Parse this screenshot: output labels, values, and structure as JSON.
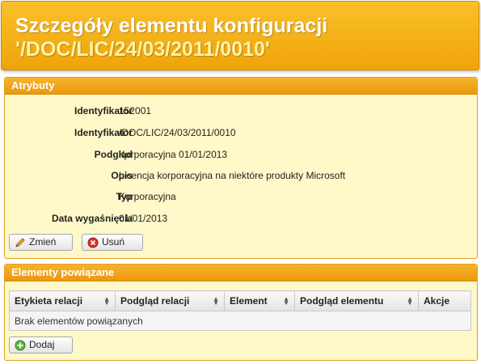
{
  "header": {
    "title": "Szczegóły elementu konfiguracji",
    "identifier": "'/DOC/LIC/24/03/2011/0010'"
  },
  "attributes": {
    "heading": "Atrybuty",
    "rows": [
      {
        "label": "Identyfikator",
        "value": "152001"
      },
      {
        "label": "Identyfikator",
        "value": "/DOC/LIC/24/03/2011/0010"
      },
      {
        "label": "Podgląd",
        "value": "Korporacyjna 01/01/2013"
      },
      {
        "label": "Opis",
        "value": "Licencja korporacyjna na niektóre produkty Microsoft"
      },
      {
        "label": "Typ",
        "value": "Korporacyjna"
      },
      {
        "label": "Data wygaśnięcia",
        "value": "01/01/2013"
      }
    ],
    "edit_label": "Zmień",
    "delete_label": "Usuń"
  },
  "related": {
    "heading": "Elementy powiązane",
    "columns": [
      "Etykieta relacji",
      "Podgląd relacji",
      "Element",
      "Podgląd elementu",
      "Akcje"
    ],
    "empty_text": "Brak elementów powiązanych",
    "add_label": "Dodaj"
  },
  "colors": {
    "accent": "#f0a30a",
    "panel_bg": "#fff8c8",
    "title_highlight": "#fff3a6"
  }
}
